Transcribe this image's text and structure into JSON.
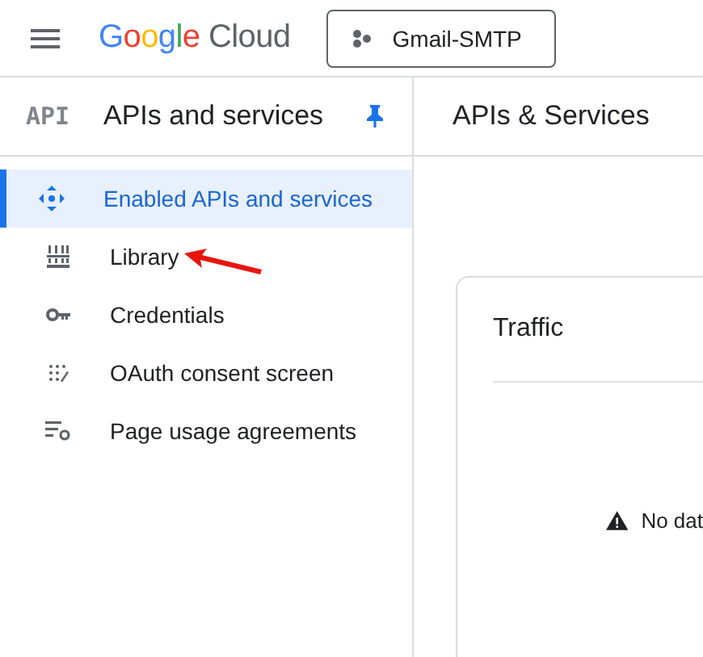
{
  "top_bar": {
    "logo": {
      "brand": "Google",
      "product": "Cloud"
    },
    "project_button": "Gmail-SMTP"
  },
  "sidebar": {
    "icon_text": "API",
    "title": "APIs and services",
    "pinned": true,
    "items": [
      {
        "label": "Enabled APIs and services",
        "kind": "hub",
        "selected": true,
        "arrow_annotation": false
      },
      {
        "label": "Library",
        "kind": "library",
        "selected": false,
        "arrow_annotation": true
      },
      {
        "label": "Credentials",
        "kind": "key",
        "selected": false,
        "arrow_annotation": false
      },
      {
        "label": "OAuth consent screen",
        "kind": "dots",
        "selected": false,
        "arrow_annotation": false
      },
      {
        "label": "Page usage agreements",
        "kind": "settings",
        "selected": false,
        "arrow_annotation": false
      }
    ]
  },
  "main": {
    "title": "APIs & Services",
    "card": {
      "title": "Traffic",
      "message": "No dat"
    }
  }
}
